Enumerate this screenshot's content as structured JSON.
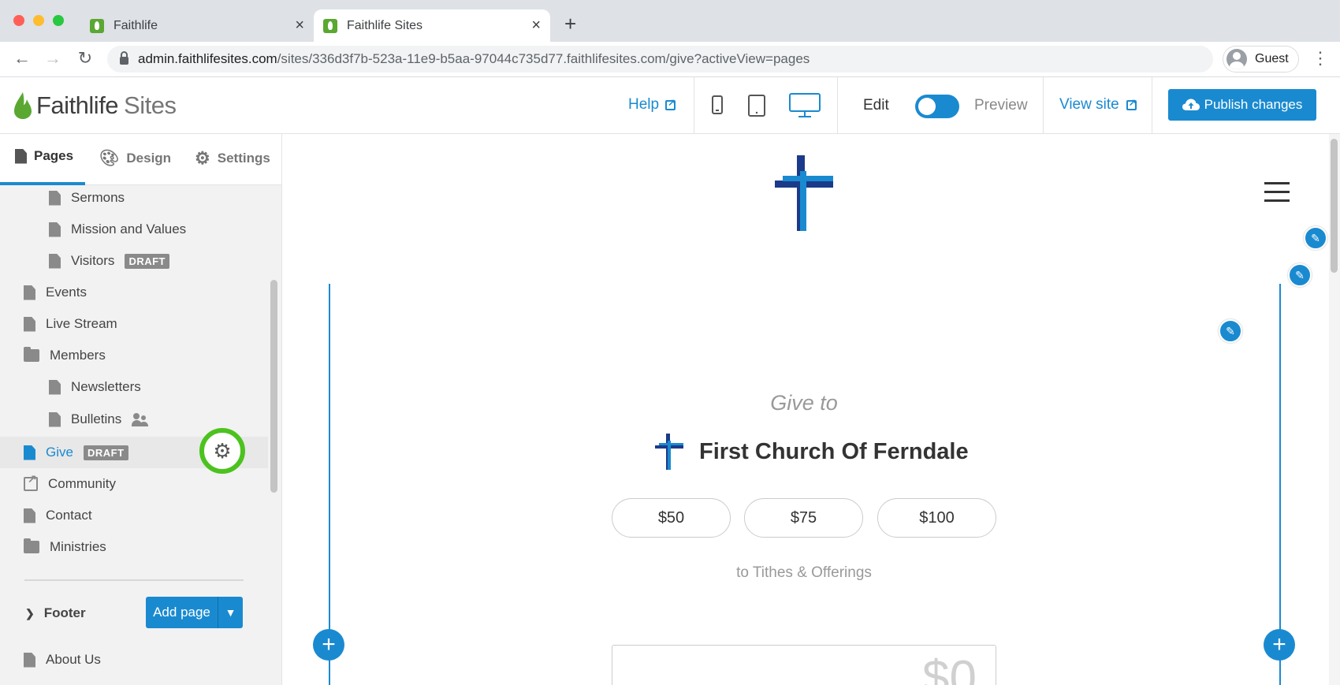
{
  "browser": {
    "tabs": [
      {
        "title": "Faithlife"
      },
      {
        "title": "Faithlife Sites"
      }
    ],
    "url_host": "admin.faithlifesites.com",
    "url_path": "/sites/336d3f7b-523a-11e9-b5aa-97044c735d77.faithlifesites.com/give?activeView=pages",
    "profile": "Guest"
  },
  "header": {
    "logo_bold": "Faithlife",
    "logo_light": "Sites",
    "help": "Help",
    "edit": "Edit",
    "preview": "Preview",
    "view_site": "View site",
    "publish": "Publish changes",
    "accent": "#1a8ad0"
  },
  "sidebar": {
    "tabs": [
      {
        "label": "Pages"
      },
      {
        "label": "Design"
      },
      {
        "label": "Settings"
      }
    ],
    "pages": [
      {
        "label": "Sermons"
      },
      {
        "label": "Mission and Values"
      },
      {
        "label": "Visitors",
        "badge": "DRAFT"
      },
      {
        "label": "Events"
      },
      {
        "label": "Live Stream"
      },
      {
        "label": "Members"
      },
      {
        "label": "Newsletters"
      },
      {
        "label": "Bulletins"
      },
      {
        "label": "Give",
        "badge": "DRAFT"
      },
      {
        "label": "Community"
      },
      {
        "label": "Contact"
      },
      {
        "label": "Ministries"
      }
    ],
    "footer_label": "Footer",
    "add_page": "Add page",
    "footer_pages": [
      {
        "label": "About Us"
      }
    ]
  },
  "preview": {
    "give_to": "Give to",
    "church_name": "First Church Of Ferndale",
    "amounts": [
      "$50",
      "$75",
      "$100"
    ],
    "fund": "to Tithes & Offerings",
    "amount_value": "$0"
  }
}
